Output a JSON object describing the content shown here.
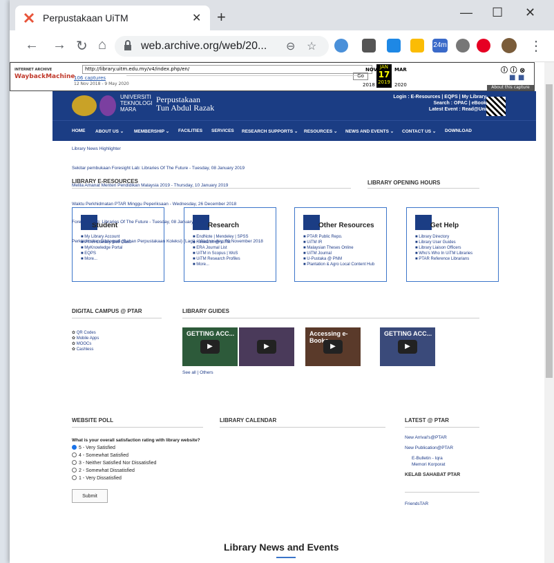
{
  "browser": {
    "tab_title": "Perpustakaan UiTM",
    "url": "web.archive.org/web/20...",
    "ext_badge": "24m"
  },
  "wayback": {
    "logo_top": "INTERNET ARCHIVE",
    "logo": "WaybackMachine",
    "url": "http://library.uitm.edu.my/v4/index.php/en/",
    "go": "Go",
    "captures": "106 captures",
    "range": "12 Nov 2018 - 9 May 2020",
    "months": [
      "NOV",
      "JAN",
      "MAR"
    ],
    "day": "17",
    "years": [
      "2018",
      "2019",
      "2020"
    ],
    "about": "About this capture"
  },
  "header": {
    "logo_text": "UNIVERSITI TEKNOLOGI MARA",
    "name_1": "Perpustakaan",
    "name_2": "Tun Abdul Razak",
    "right_1": "Login : E-Resources | EQPS | My Library",
    "right_2": "Search : OPAC | eBook",
    "right_3": "Latest Event : Read@Uni"
  },
  "nav": [
    "HOME",
    "ABOUT US ⌄",
    "MEMBERSHIP ⌄",
    "FACILITIES",
    "SERVICES",
    "RESEARCH SUPPORTS ⌄",
    "RESOURCES ⌄",
    "NEWS AND EVENTS ⌄",
    "CONTACT US ⌄",
    "DOWNLOAD"
  ],
  "news_highlight": "Library News Highlighter",
  "news_items": [
    "Sekitar pembukaan Foresight Lab: Libraries Of The Future - Tuesday, 08 January 2019",
    "Melila Amanat Menteri Pendidikan Malaysia 2019 - Thursday, 10 January 2019",
    "Waktu Perkhidmatan PTAR Minggu Peperiksaan - Wednesday, 26 December 2018",
    "Foresight Lab: Libraries Of The Future - Tuesday, 08 January 2019",
    "Perkhidmatan Bibliografi (Bahan Perpustakaan Koleksi) (Lagi) - Wednesday, 01 November 2018"
  ],
  "sections": {
    "eresources": "LIBRARY E-RESOURCES",
    "hours": "LIBRARY OPENING HOURS",
    "digital": "DIGITAL CAMPUS @ PTAR",
    "guides": "LIBRARY GUIDES",
    "poll": "WEBSITE POLL",
    "calendar": "LIBRARY CALENDAR",
    "latest": "LATEST @ PTAR",
    "kelab": "KELAB SAHABAT PTAR"
  },
  "cards": [
    {
      "title": "Student",
      "items": [
        "My Library Account",
        "PTAR Literacy Skill Class",
        "MyKnowledge Portal",
        "EQPS",
        "More..."
      ]
    },
    {
      "title": "Research",
      "items": [
        "EndNote | Mendeley | SPSS",
        "Research @ UiTM",
        "ERA Journal List",
        "UiTM in Scopus | WoS",
        "UiTM Research Profiles",
        "More..."
      ]
    },
    {
      "title": "Other Resources",
      "items": [
        "PTAR Public Repo.",
        "UiTM IR",
        "Malaysian Theses Online",
        "UiTM Journal",
        "U-Pustaka @ PNM",
        "Plantation & Agro Local Content Hub"
      ]
    },
    {
      "title": "Get Help",
      "items": [
        "Library Directory",
        "Library User Guides",
        "Library Liaison Officers",
        "Who's Who In UiTM Libraries",
        "PTAR Reference Librarians"
      ]
    }
  ],
  "digital_items": [
    "QR Codes",
    "Mobile Apps",
    "MOOCs",
    "Cashless"
  ],
  "videos": [
    "GETTING ACC...",
    "",
    "Accessing e-Books",
    "GETTING ACC..."
  ],
  "see_all": "See all | Others",
  "poll": {
    "question": "What is your overall satisfaction rating with library website?",
    "options": [
      "5 - Very Satisfied",
      "4 - Somewhat Satisfied",
      "3 - Neither Satisfied Nor Dissatisfied",
      "2 - Somewhat Dissatisfied",
      "1 - Very Dissatisfied"
    ],
    "submit": "Submit"
  },
  "latest": [
    "New Arrival's@PTAR",
    "New Publication@PTAR",
    "E-Bulletin - Iqra",
    "Memori Korporat"
  ],
  "friends": "FriendsTAR",
  "news_events": "Library News and Events"
}
